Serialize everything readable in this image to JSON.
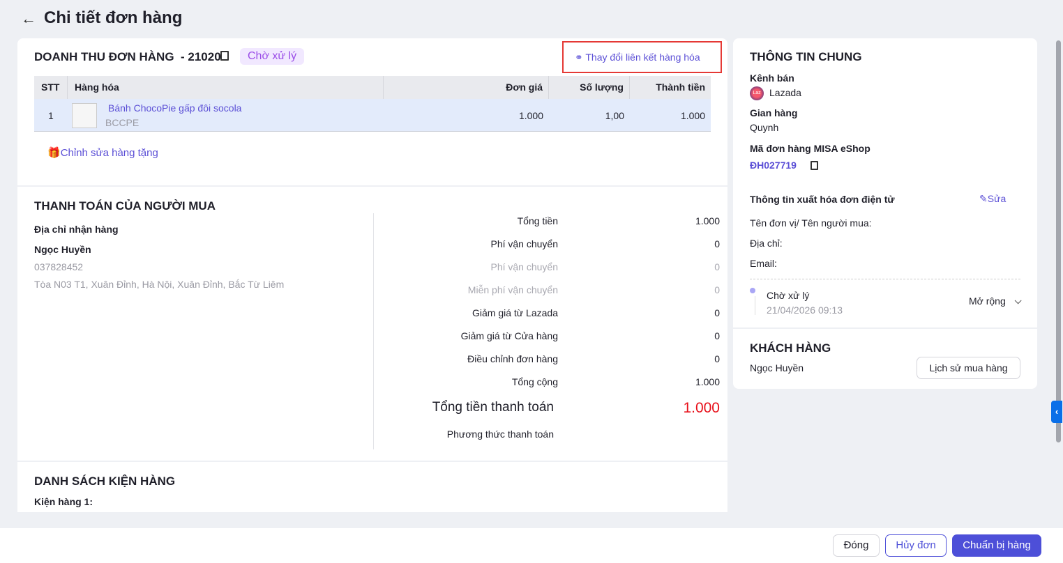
{
  "header": {
    "title": "Chi tiết đơn hàng"
  },
  "order": {
    "title": "DOANH THU ĐƠN HÀNG  - 21020",
    "status": "Chờ xử lý",
    "change_link": "Thay đổi liên kết hàng hóa",
    "columns": [
      "STT",
      "Hàng hóa",
      "Đơn giá",
      "Số lượng",
      "Thành tiền"
    ],
    "rows": [
      {
        "stt": "1",
        "name": "Bánh ChocoPie gấp đôi socola",
        "sku": "BCCPE",
        "price": "1.000",
        "qty": "1,00",
        "total": "1.000"
      }
    ],
    "edit_gift": "Chỉnh sửa hàng tặng"
  },
  "payment": {
    "title": "THANH TOÁN CỦA NGƯỜI MUA",
    "address_label": "Địa chỉ nhận hàng",
    "name": "Ngọc Huyền",
    "phone": "037828452",
    "address": "Tòa N03 T1, Xuân Đỉnh, Hà Nội, Xuân Đỉnh, Bắc Từ Liêm",
    "lines": [
      {
        "label": "Tổng tiền",
        "value": "1.000",
        "muted": false
      },
      {
        "label": "Phí vận chuyển",
        "value": "0",
        "muted": false
      },
      {
        "label": "Phí vận chuyển",
        "value": "0",
        "muted": true
      },
      {
        "label": "Miễn phí vận chuyển",
        "value": "0",
        "muted": true
      },
      {
        "label": "Giảm giá từ Lazada",
        "value": "0",
        "muted": false
      },
      {
        "label": "Giảm giá từ Cửa hàng",
        "value": "0",
        "muted": false
      },
      {
        "label": "Điều chỉnh đơn hàng",
        "value": "0",
        "muted": false
      },
      {
        "label": "Tổng cộng",
        "value": "1.000",
        "muted": false
      }
    ],
    "grand_label": "Tổng tiền thanh toán",
    "grand_value": "1.000",
    "method_label": "Phương thức thanh toán"
  },
  "packages": {
    "title": "DANH SÁCH KIỆN HÀNG",
    "item": "Kiện hàng 1:"
  },
  "info": {
    "title": "THÔNG TIN CHUNG",
    "channel_label": "Kênh bán",
    "channel": "Lazada",
    "channel_logo": "Laz",
    "store_label": "Gian hàng",
    "store": "Quynh",
    "code_label": "Mã đơn hàng MISA eShop",
    "code": "ĐH027719",
    "invoice_label": "Thông tin xuất hóa đơn điện tử",
    "edit": "Sửa",
    "buyer_label": "Tên đơn vị/ Tên người mua:",
    "addr_label": "Địa chỉ:",
    "email_label": "Email:",
    "timeline_status": "Chờ xử lý",
    "timeline_time": "21/04/2026 09:13",
    "expand": "Mở rộng"
  },
  "customer": {
    "title": "KHÁCH HÀNG",
    "name": "Ngọc Huyền",
    "history": "Lịch sử mua hàng"
  },
  "footer": {
    "close": "Đóng",
    "cancel": "Hủy đơn",
    "prepare": "Chuẩn bị hàng"
  },
  "colors": {
    "accent": "#5b4fd6",
    "primary": "#4d4fd8",
    "danger": "#e8101a",
    "highlight": "#e53935"
  }
}
